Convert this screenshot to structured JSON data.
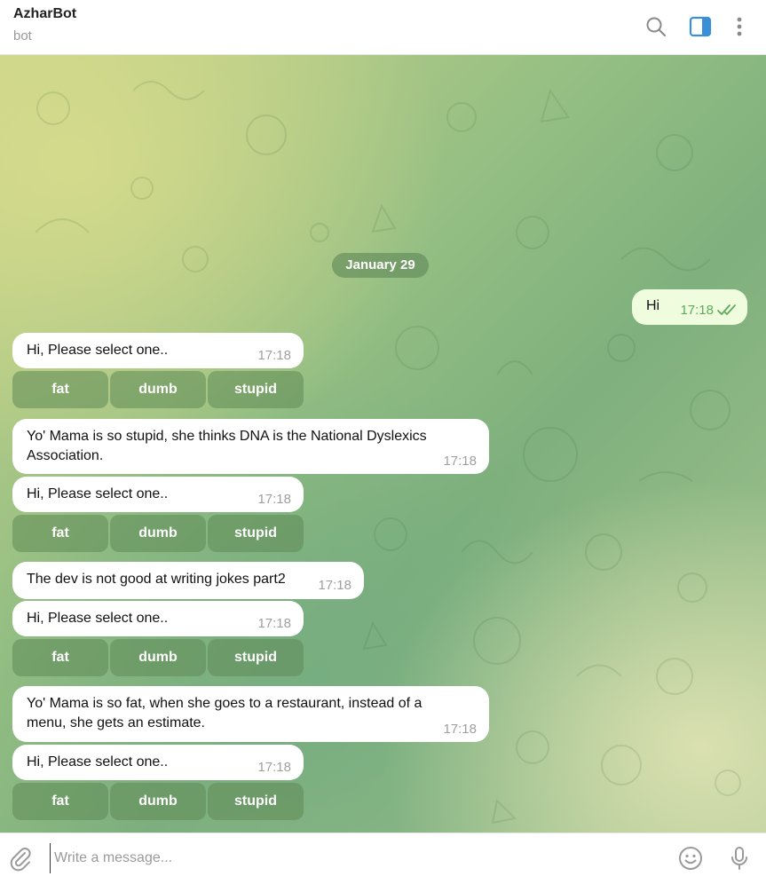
{
  "header": {
    "title": "AzharBot",
    "subtitle": "bot",
    "icons": [
      "search-icon",
      "sidebar-toggle-icon",
      "more-vertical-icon"
    ],
    "accent_color": "#3a8fd6"
  },
  "chat": {
    "date_label": "January 29",
    "outgoing": [
      {
        "text": "Hi",
        "time": "17:18",
        "status": "read"
      }
    ],
    "messages": [
      {
        "text": "Hi, Please select one..",
        "time": "17:18",
        "buttons": [
          "fat",
          "dumb",
          "stupid"
        ]
      },
      {
        "text": "Yo' Mama is so stupid, she thinks DNA is the National Dyslexics Association.",
        "line1": "Yo' Mama is so stupid, she thinks DNA is the National Dyslexics",
        "line2": "Association.",
        "time": "17:18"
      },
      {
        "text": "Hi, Please select one..",
        "time": "17:18",
        "buttons": [
          "fat",
          "dumb",
          "stupid"
        ]
      },
      {
        "text": "The dev is not good at writing jokes part2",
        "time": "17:18"
      },
      {
        "text": "Hi, Please select one..",
        "time": "17:18",
        "buttons": [
          "fat",
          "dumb",
          "stupid"
        ]
      },
      {
        "text": "Yo' Mama is so fat, when she goes to a restaurant, instead of a menu, she gets an estimate.",
        "line1": "Yo' Mama is so fat, when she goes to a restaurant, instead of a",
        "line2": "menu, she gets an estimate.",
        "time": "17:18"
      },
      {
        "text": "Hi, Please select one..",
        "time": "17:18",
        "buttons": [
          "fat",
          "dumb",
          "stupid"
        ]
      }
    ]
  },
  "composer": {
    "placeholder": "Write a message...",
    "value": "",
    "icons": [
      "attach-icon",
      "emoji-icon",
      "microphone-icon"
    ]
  },
  "colors": {
    "outgoing_bubble": "#effdde",
    "incoming_bubble": "#ffffff",
    "keyboard_button": "#5e8a56",
    "read_check": "#5eaa5e"
  }
}
